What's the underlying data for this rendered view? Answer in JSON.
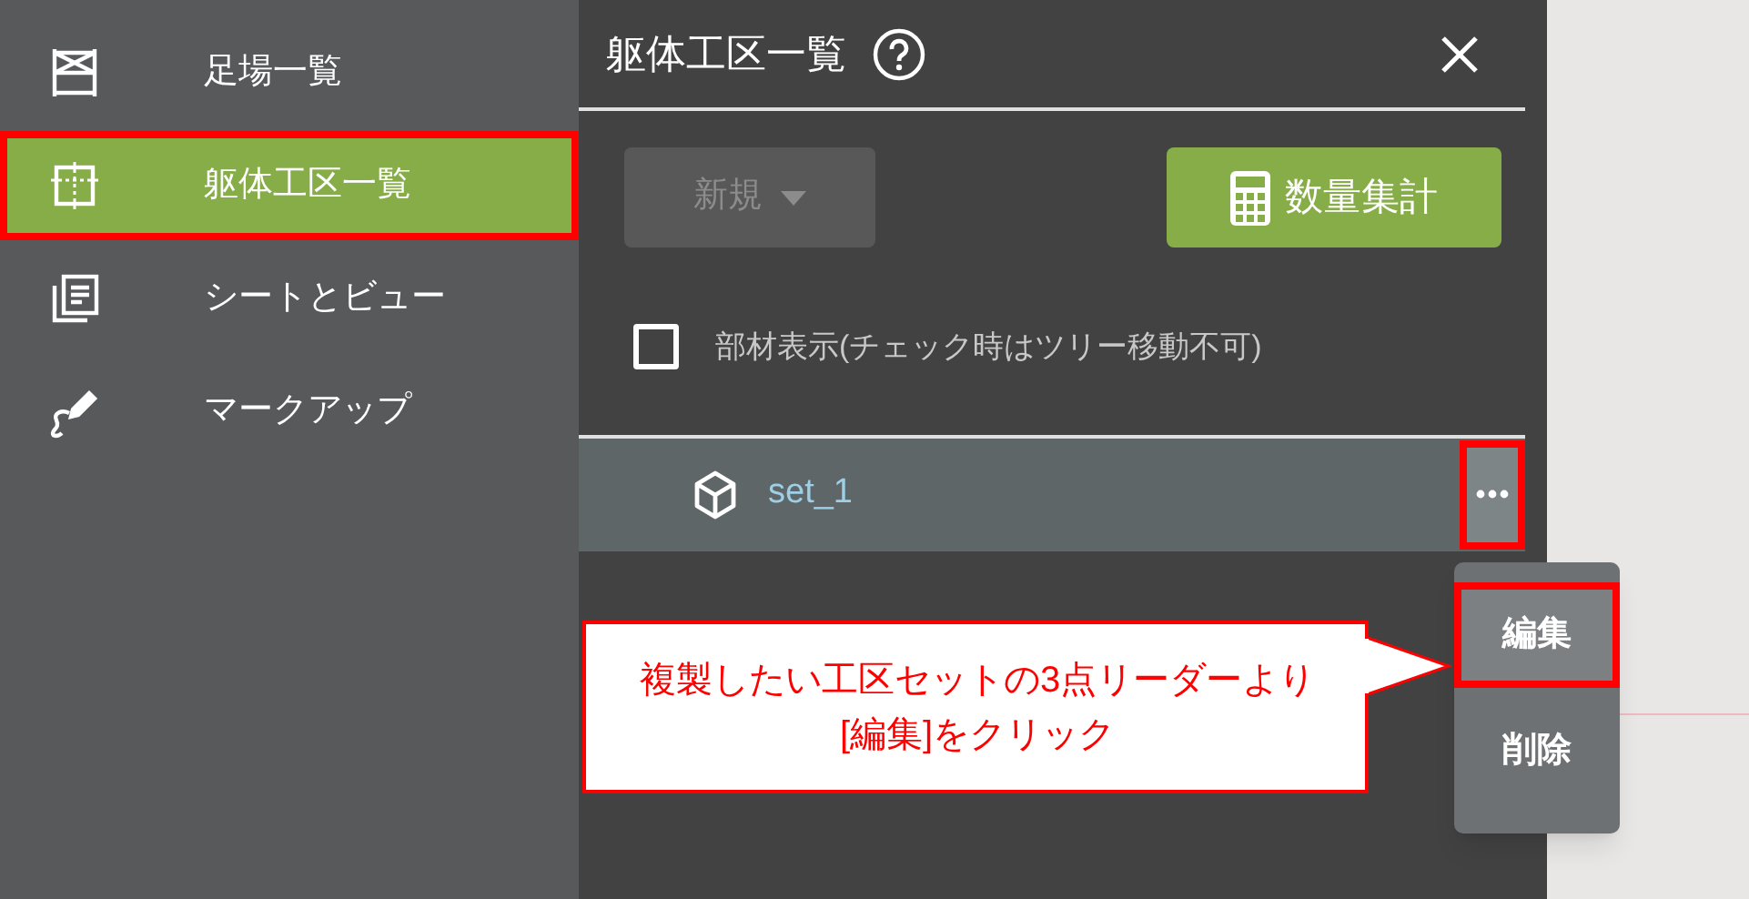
{
  "sidebar": {
    "items": [
      {
        "kind": "scaffold",
        "label": "足場一覧",
        "selected": false,
        "highlighted": false
      },
      {
        "kind": "zone",
        "label": "躯体工区一覧",
        "selected": true,
        "highlighted": true
      },
      {
        "kind": "sheets",
        "label": "シートとビュー",
        "selected": false,
        "highlighted": false
      },
      {
        "kind": "markup",
        "label": "マークアップ",
        "selected": false,
        "highlighted": false
      }
    ]
  },
  "panel": {
    "title": "躯体工区一覧",
    "new_button": {
      "label": "新規",
      "disabled": true
    },
    "count_button": {
      "label": "数量集計"
    },
    "checkbox": {
      "label": "部材表示(チェック時はツリー移動不可)",
      "checked": false
    },
    "rows": [
      {
        "label": "set_1",
        "selected": true,
        "menu_highlighted": true
      }
    ],
    "menu": {
      "items": [
        {
          "label": "編集",
          "highlighted": true
        },
        {
          "label": "削除",
          "highlighted": false
        }
      ]
    }
  },
  "callout": {
    "lines": [
      "複製したい工区セットの3点リーダーより",
      "[編集]をクリック"
    ]
  }
}
